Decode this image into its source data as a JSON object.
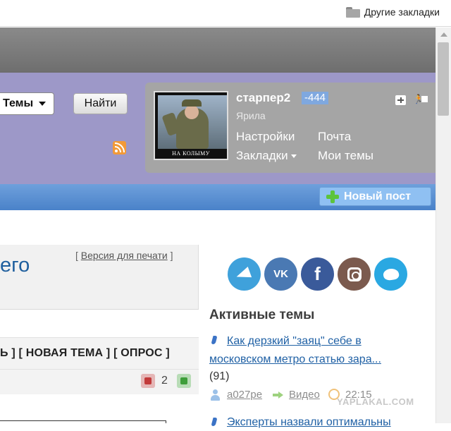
{
  "bookmarks": {
    "other_bookmarks": "Другие закладки"
  },
  "search": {
    "scope": "Темы",
    "find_label": "Найти"
  },
  "user": {
    "avatar_caption": "НА КОЛЫМУ",
    "name": "старпер2",
    "karma": "-444",
    "rank": "Ярила",
    "links": {
      "settings": "Настройки",
      "mail": "Почта",
      "bookmarks": "Закладки",
      "my_topics": "Мои темы"
    }
  },
  "nav": {
    "new_post": "Новый пост"
  },
  "post": {
    "title_fragment": "его",
    "print_version": "Версия для печати",
    "bracket_open": "[",
    "bracket_close": "]",
    "mod_links": "Ь ] [ НОВАЯ ТЕМА ] [ ОПРОС ]",
    "vote_count": "2"
  },
  "sidebar": {
    "active_topics_title": "Активные темы",
    "topics": [
      {
        "title_line1": "Как дерзкий \"заяц\" себе в",
        "title_line2": "московском метро статью зара...",
        "count": "(91)",
        "author": "a027pe",
        "category": "Видео",
        "time": "22:15"
      },
      {
        "title_line1": "Эксперты назвали оптимальны"
      }
    ]
  },
  "watermark": "YAPLAKAL.COM",
  "colors": {
    "header": "#9d98c8",
    "nav_strip": "#5b8fd3",
    "link": "#2061a5",
    "karma": "#7fa8df"
  }
}
